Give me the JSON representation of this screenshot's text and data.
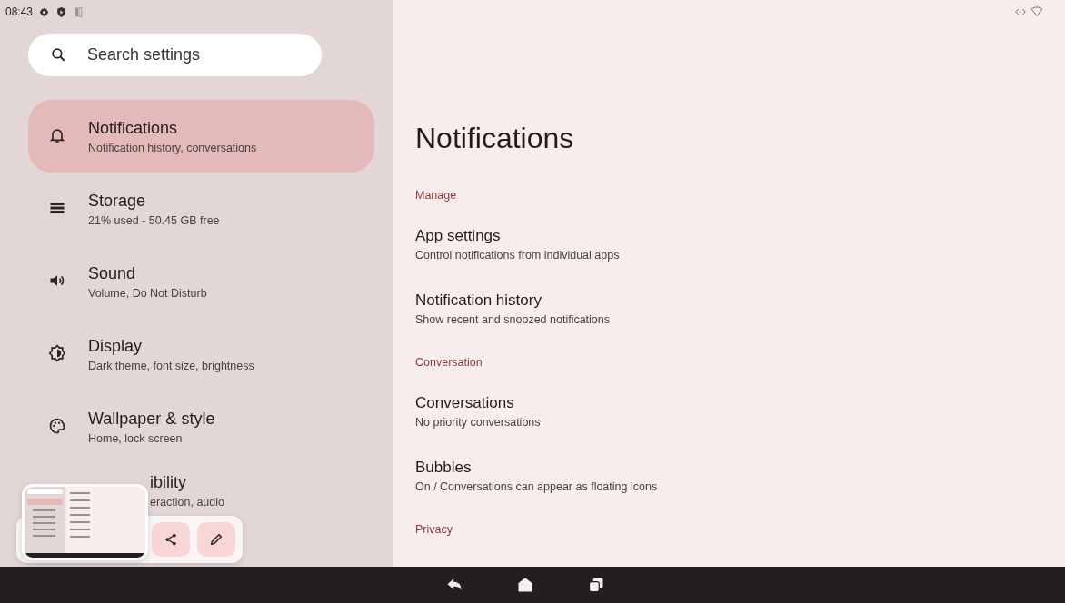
{
  "status_bar": {
    "time": "08:43"
  },
  "search": {
    "placeholder": "Search settings"
  },
  "sidebar": {
    "items": [
      {
        "kind": "row",
        "title": "Notifications",
        "subtitle": "Notification history, conversations",
        "selected": true
      },
      {
        "kind": "row",
        "title": "Storage",
        "subtitle": "21% used - 50.45 GB free",
        "selected": false
      },
      {
        "kind": "row",
        "title": "Sound",
        "subtitle": "Volume, Do Not Disturb",
        "selected": false
      },
      {
        "kind": "row",
        "title": "Display",
        "subtitle": "Dark theme, font size, brightness",
        "selected": false
      },
      {
        "kind": "row",
        "title": "Wallpaper & style",
        "subtitle": "Home, lock screen",
        "selected": false
      },
      {
        "kind": "covered",
        "title": "ibility",
        "subtitle": "eraction, audio",
        "selected": false
      }
    ]
  },
  "page": {
    "title": "Notifications",
    "sections": [
      {
        "header": "Manage",
        "items": [
          {
            "title": "App settings",
            "subtitle": "Control notifications from individual apps"
          },
          {
            "title": "Notification history",
            "subtitle": "Show recent and snoozed notifications"
          }
        ]
      },
      {
        "header": "Conversation",
        "items": [
          {
            "title": "Conversations",
            "subtitle": "No priority conversations"
          },
          {
            "title": "Bubbles",
            "subtitle": "On / Conversations can appear as floating icons"
          }
        ]
      },
      {
        "header": "Privacy"
      }
    ]
  }
}
